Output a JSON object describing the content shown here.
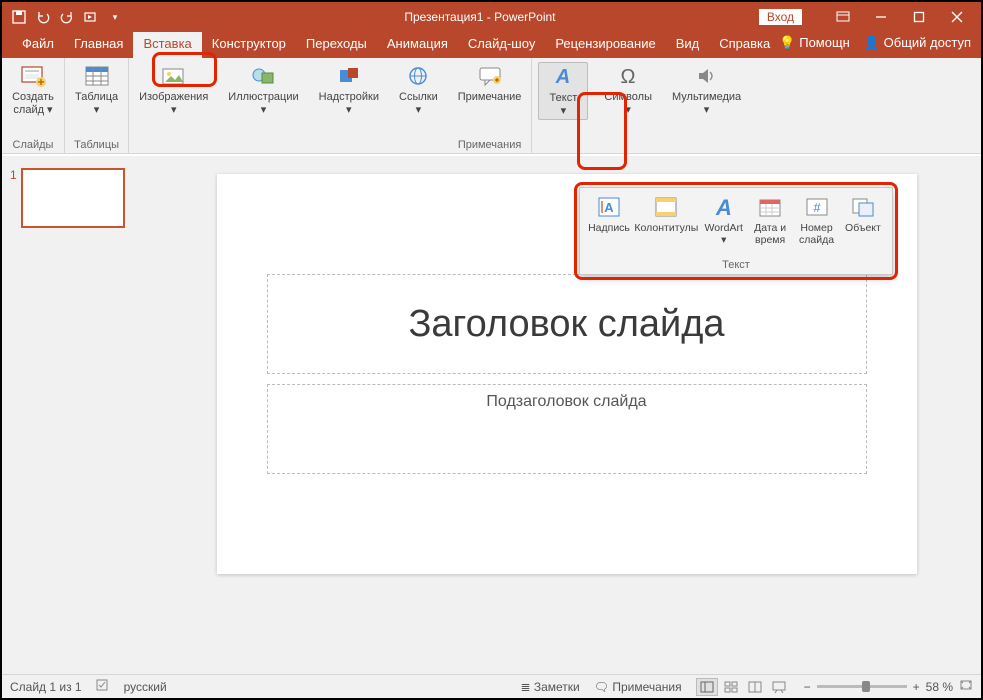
{
  "titlebar": {
    "title": "Презентация1 - PowerPoint",
    "login": "Вход"
  },
  "tabs": {
    "file": "Файл",
    "home": "Главная",
    "insert": "Вставка",
    "design": "Конструктор",
    "transitions": "Переходы",
    "animations": "Анимация",
    "slideshow": "Слайд-шоу",
    "review": "Рецензирование",
    "view": "Вид",
    "help": "Справка",
    "tellme": "Помощн",
    "share": "Общий доступ"
  },
  "ribbon": {
    "new_slide": "Создать\nслайд ▾",
    "slides_group": "Слайды",
    "table": "Таблица\n▾",
    "tables_group": "Таблицы",
    "images": "Изображения\n▾",
    "illustrations": "Иллюстрации\n▾",
    "addins": "Надстройки\n▾",
    "links": "Ссылки\n▾",
    "comment": "Примечание",
    "comments_group": "Примечания",
    "text": "Текст\n▾",
    "symbols": "Символы\n▾",
    "media": "Мультимедиа\n▾"
  },
  "popup": {
    "textbox": "Надпись",
    "headerfooter": "Колонтитулы",
    "wordart": "WordArt\n▾",
    "datetime": "Дата и\nвремя",
    "slidenumber": "Номер\nслайда",
    "object": "Объект",
    "group": "Текст"
  },
  "slide": {
    "number": "1",
    "title_ph": "Заголовок слайда",
    "subtitle_ph": "Подзаголовок слайда"
  },
  "status": {
    "slide_count": "Слайд 1 из 1",
    "lang": "русский",
    "notes": "Заметки",
    "comments": "Примечания",
    "zoom": "58 %"
  }
}
